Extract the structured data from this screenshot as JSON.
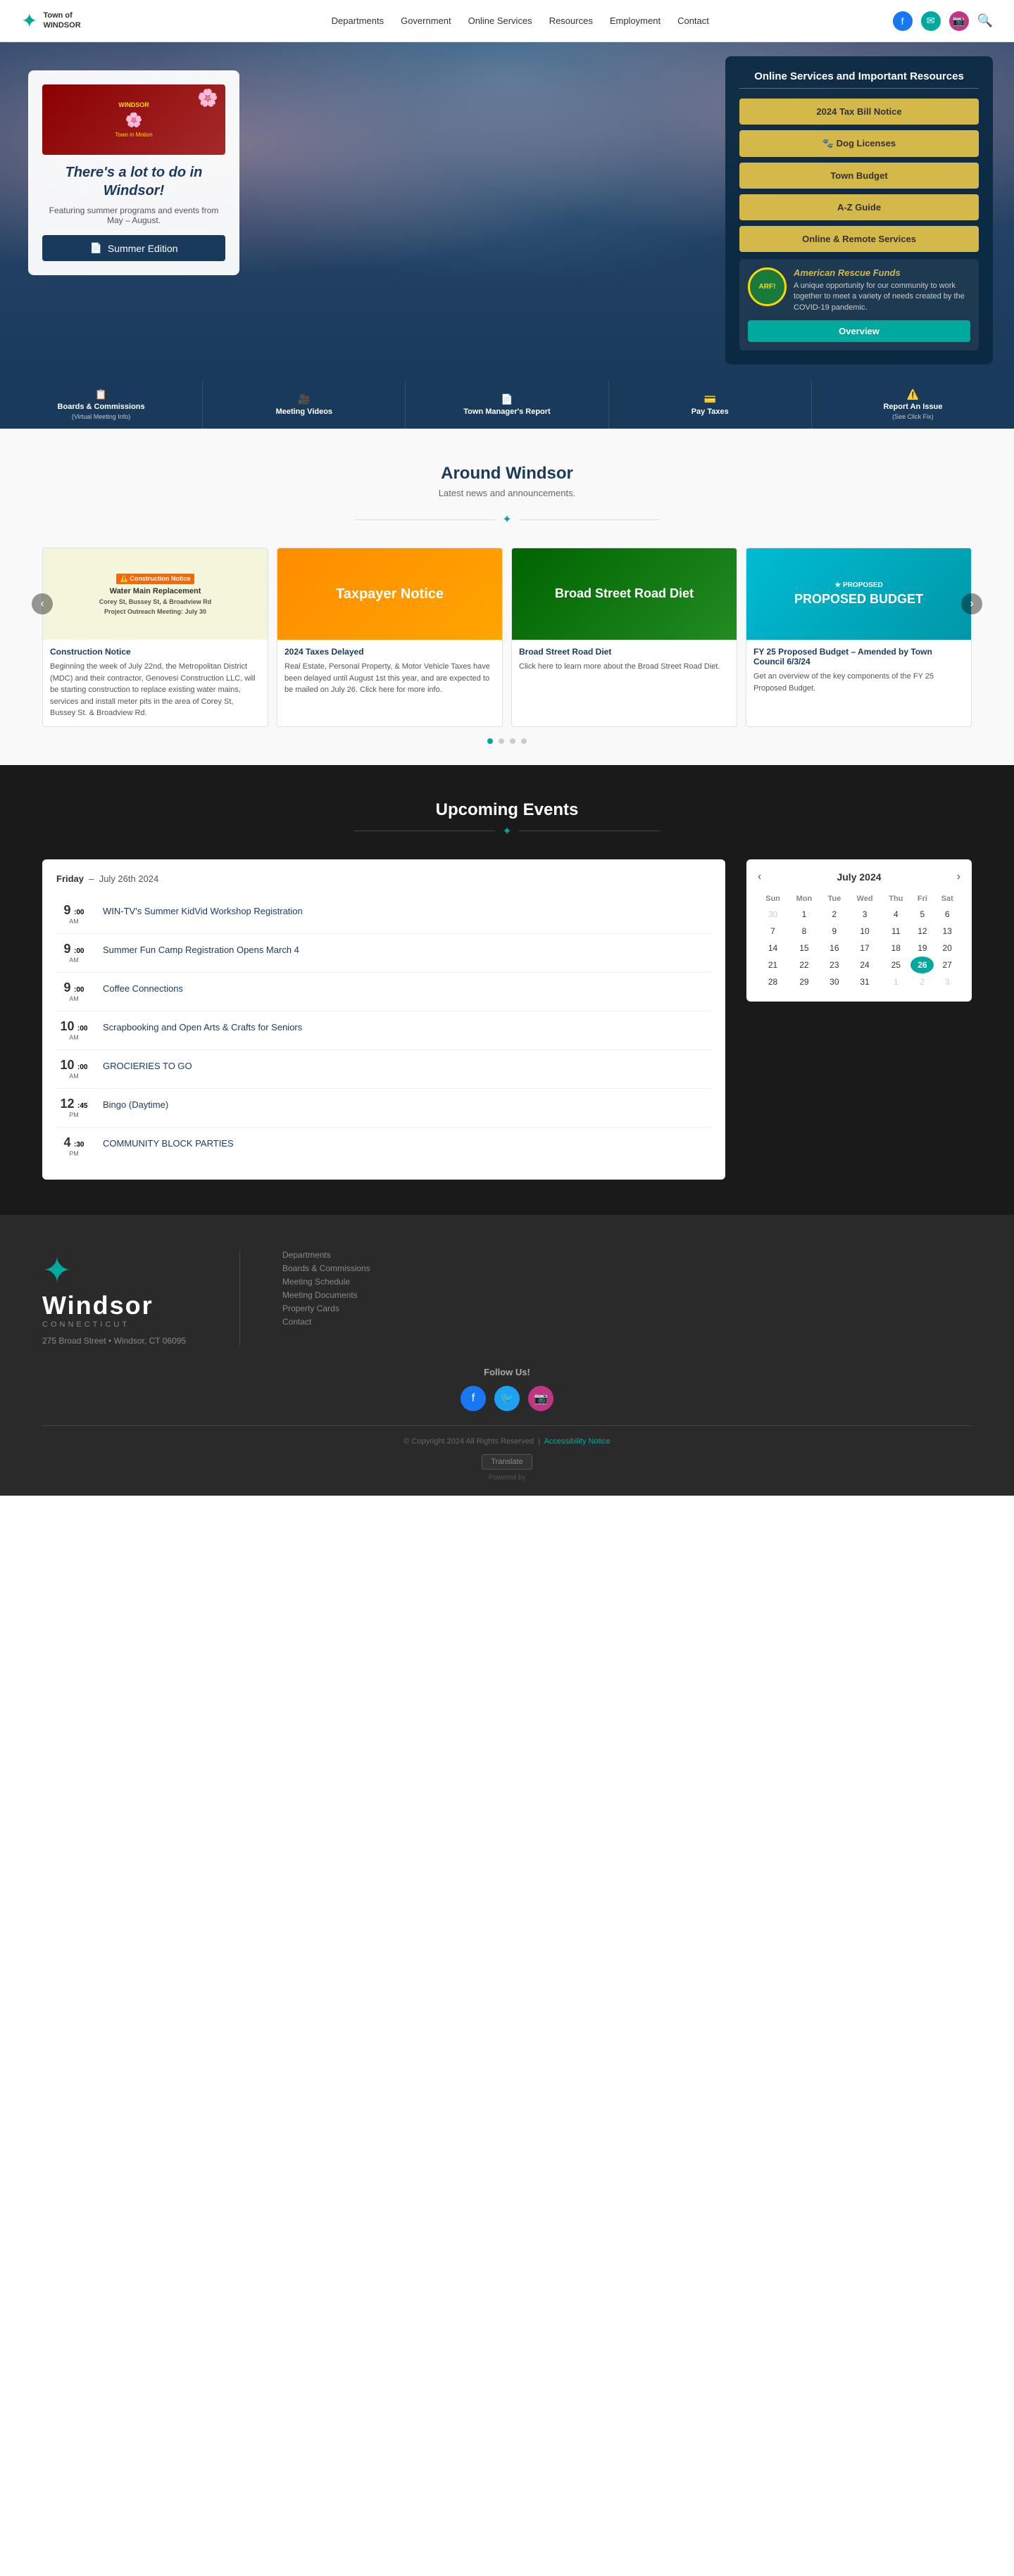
{
  "header": {
    "logo_name": "Town of WINDSOR",
    "nav_items": [
      "Departments",
      "Government",
      "Online Services",
      "Resources",
      "Employment",
      "Contact"
    ],
    "search_placeholder": "Search..."
  },
  "hero": {
    "book_label": "WINDSOR",
    "book_subtitle": "Town in Motion",
    "heading": "There's a lot to do in Windsor!",
    "subtext": "Featuring summer programs and events from May – August.",
    "summer_btn": "Summer Edition",
    "panel_title": "Online Services and Important Resources",
    "quick_links": [
      "2024 Tax Bill Notice",
      "Dog Licenses",
      "Town Budget",
      "A-Z Guide",
      "Online & Remote Services"
    ],
    "arf_title": "American Rescue Funds",
    "arf_text": "A unique opportunity for our community to work together to meet a variety of needs created by the COVID-19 pandemic.",
    "arf_logo_text": "ARF!",
    "overview_btn": "Overview"
  },
  "quicklinks_bar": [
    {
      "icon": "📋",
      "label": "Boards & Commissions",
      "sub": "(Virtual Meeting Info)"
    },
    {
      "icon": "🎥",
      "label": "Meeting Videos",
      "sub": ""
    },
    {
      "icon": "📄",
      "label": "Town Manager's Report",
      "sub": ""
    },
    {
      "icon": "💳",
      "label": "Pay Taxes",
      "sub": ""
    },
    {
      "icon": "⚠️",
      "label": "Report An Issue",
      "sub": "(See Click Fix)"
    }
  ],
  "around_windsor": {
    "title": "Around Windsor",
    "subtitle": "Latest news and announcements.",
    "cards": [
      {
        "type": "construction",
        "title": "Construction Notice",
        "badge": "⚠️",
        "img_text": "Construction Notice",
        "img_sub": "Water Main Replacement\nCorey St, Bussey St, & Broadview Rd\nProject Outreach Meeting: July 30",
        "text": "Beginning the week of July 22nd, the Metropolitan District (MDC) and their contractor, Genovesi Construction LLC, will be starting construction to replace existing water mains, services and install meter pits in the area of Corey St, Bussey St. & Broadview Rd."
      },
      {
        "type": "taxpayer",
        "title": "2024 Taxes Delayed",
        "img_text": "Taxpayer Notice",
        "text": "Real Estate, Personal Property, & Motor Vehicle Taxes have been delayed until August 1st this year, and are expected to be mailed on July 26. Click here for more info."
      },
      {
        "type": "broad",
        "title": "Broad Street Road Diet",
        "img_text": "Broad Street Road Diet",
        "text": "Click here to learn more about the Broad Street Road Diet."
      },
      {
        "type": "budget",
        "title": "FY 25 Proposed Budget – Amended by Town Council 6/3/24",
        "img_text": "PROPOSED BUDGET",
        "text": "Get an overview of the key components of the FY 25 Proposed Budget."
      }
    ]
  },
  "events": {
    "title": "Upcoming Events",
    "subtitle": "",
    "date_header_day": "Friday",
    "date_header_date": "July 26th 2024",
    "items": [
      {
        "hour": "9",
        "min": "00",
        "ampm": "AM",
        "name": "WIN-TV's Summer KidVid Workshop Registration"
      },
      {
        "hour": "9",
        "min": "00",
        "ampm": "AM",
        "name": "Summer Fun Camp Registration Opens March 4"
      },
      {
        "hour": "9",
        "min": "00",
        "ampm": "AM",
        "name": "Coffee Connections"
      },
      {
        "hour": "10",
        "min": "00",
        "ampm": "AM",
        "name": "Scrapbooking and Open Arts & Crafts for Seniors"
      },
      {
        "hour": "10",
        "min": "00",
        "ampm": "AM",
        "name": "GROCIERIES TO GO"
      },
      {
        "hour": "12",
        "min": "45",
        "ampm": "PM",
        "name": "Bingo (Daytime)"
      },
      {
        "hour": "4",
        "min": "30",
        "ampm": "PM",
        "name": "COMMUNITY BLOCK PARTIES"
      }
    ]
  },
  "calendar": {
    "title": "July 2024",
    "days_header": [
      "Sun",
      "Mon",
      "Tue",
      "Wed",
      "Thu",
      "Fri",
      "Sat"
    ],
    "weeks": [
      [
        {
          "d": "30",
          "m": "other"
        },
        {
          "d": "1"
        },
        {
          "d": "2"
        },
        {
          "d": "3"
        },
        {
          "d": "4"
        },
        {
          "d": "5"
        },
        {
          "d": "6"
        }
      ],
      [
        {
          "d": "7"
        },
        {
          "d": "8"
        },
        {
          "d": "9"
        },
        {
          "d": "10"
        },
        {
          "d": "11"
        },
        {
          "d": "12"
        },
        {
          "d": "13"
        }
      ],
      [
        {
          "d": "14"
        },
        {
          "d": "15"
        },
        {
          "d": "16"
        },
        {
          "d": "17"
        },
        {
          "d": "18"
        },
        {
          "d": "19"
        },
        {
          "d": "20"
        }
      ],
      [
        {
          "d": "21"
        },
        {
          "d": "22"
        },
        {
          "d": "23"
        },
        {
          "d": "24"
        },
        {
          "d": "25"
        },
        {
          "d": "26",
          "today": true
        },
        {
          "d": "27"
        }
      ],
      [
        {
          "d": "28"
        },
        {
          "d": "29"
        },
        {
          "d": "30"
        },
        {
          "d": "31"
        },
        {
          "d": "1",
          "m": "future"
        },
        {
          "d": "2",
          "m": "future"
        },
        {
          "d": "3",
          "m": "future"
        }
      ]
    ]
  },
  "footer": {
    "logo_text": "Windsor",
    "ct_text": "CONNECTICUT",
    "address": "275 Broad Street • Windsor, CT 06095",
    "follow_text": "Follow Us!",
    "links": [
      "Departments",
      "Boards & Commissions",
      "Meeting Schedule",
      "Meeting Documents",
      "Property Cards",
      "Contact"
    ],
    "copyright": "© Copyright 2024 All Rights Reserved",
    "privacy_link": "Accessibility Notice",
    "powered_by": "Powered by",
    "translate": "Translate"
  },
  "social": {
    "fb_color": "#1877f2",
    "tw_color": "#1da1f2",
    "ig_color": "#c13584"
  }
}
